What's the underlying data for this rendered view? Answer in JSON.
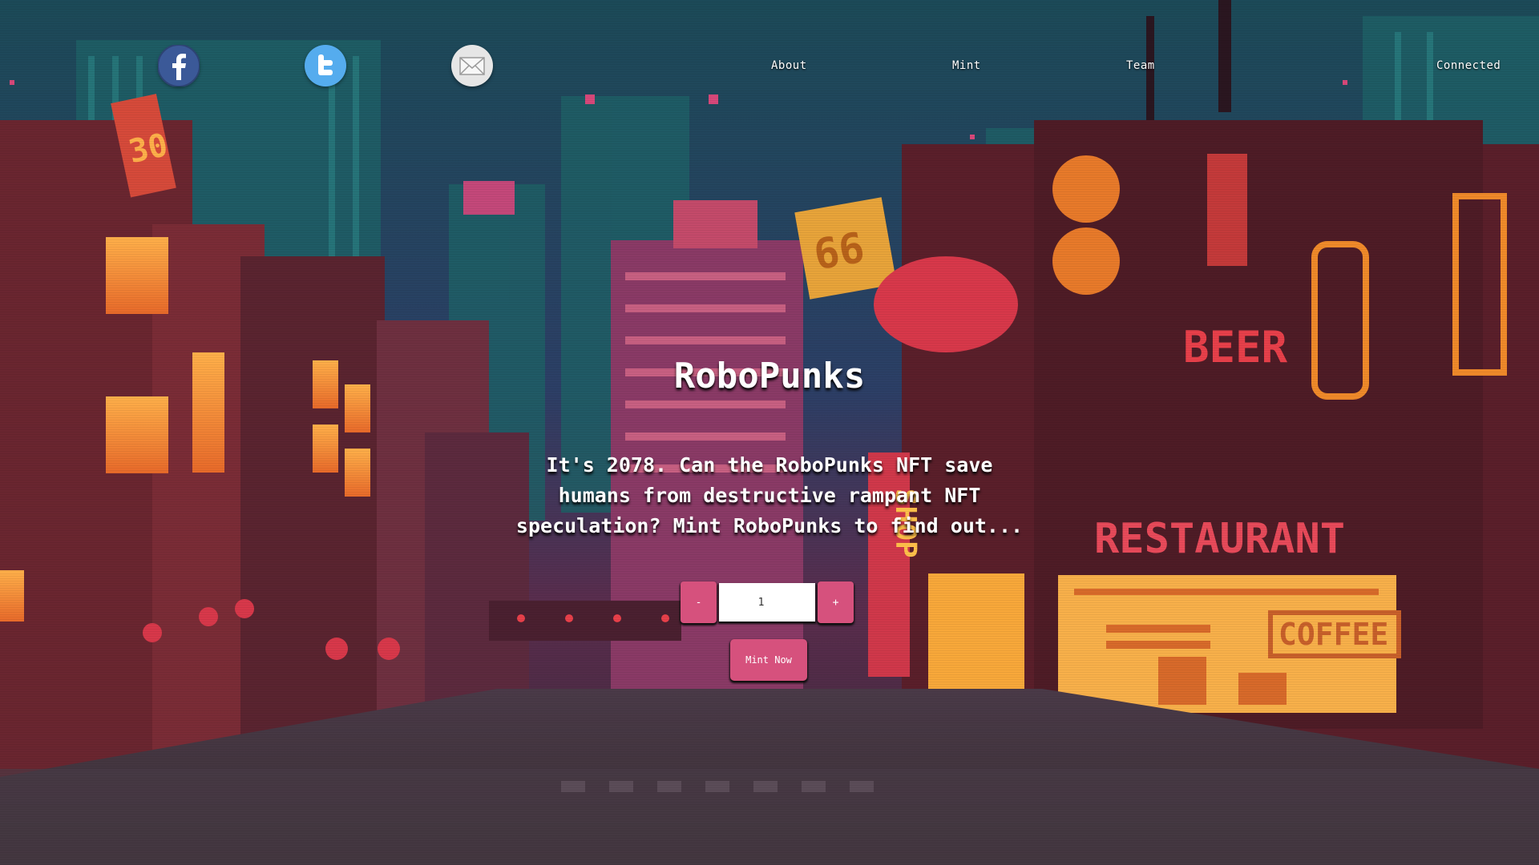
{
  "nav": {
    "social": [
      {
        "name": "facebook",
        "icon": "facebook-icon",
        "color": "#3b5998"
      },
      {
        "name": "twitter",
        "icon": "twitter-icon",
        "color": "#55acee"
      },
      {
        "name": "email",
        "icon": "email-icon",
        "color": "#e6e6e6"
      }
    ],
    "links": {
      "about": "About",
      "mint": "Mint",
      "team": "Team",
      "connected": "Connected"
    }
  },
  "hero": {
    "title": "RoboPunks",
    "description": "It's 2078. Can the RoboPunks NFT save humans from destructive rampant NFT speculation? Mint RoboPunks to find out..."
  },
  "mint": {
    "decrement_label": "-",
    "quantity_value": "1",
    "increment_label": "+",
    "mint_button_label": "Mint Now"
  },
  "background": {
    "scene": "pixel-art cyberpunk city street at night",
    "signs": [
      "30",
      "66",
      "BEER",
      "RESTAURANT",
      "COFFEE",
      "SHOP"
    ]
  },
  "colors": {
    "accent": "#d6517d",
    "text": "#ffffff"
  }
}
